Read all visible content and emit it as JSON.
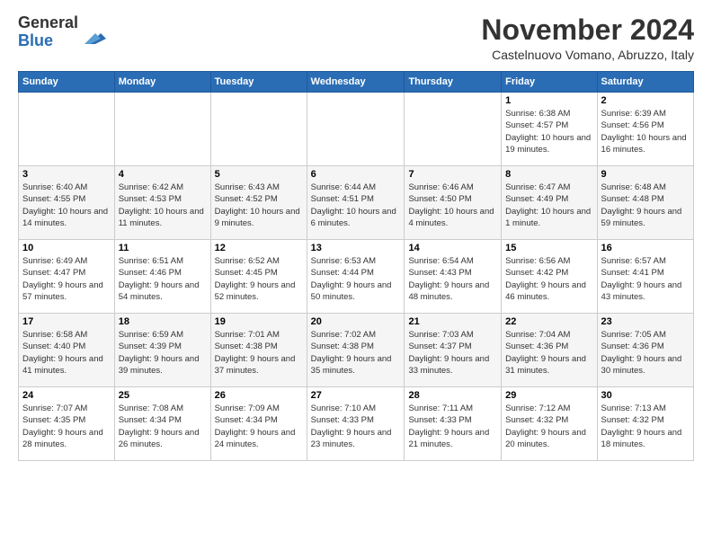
{
  "logo": {
    "line1": "General",
    "line2": "Blue"
  },
  "title": "November 2024",
  "location": "Castelnuovo Vomano, Abruzzo, Italy",
  "days_of_week": [
    "Sunday",
    "Monday",
    "Tuesday",
    "Wednesday",
    "Thursday",
    "Friday",
    "Saturday"
  ],
  "weeks": [
    [
      {
        "day": "",
        "info": ""
      },
      {
        "day": "",
        "info": ""
      },
      {
        "day": "",
        "info": ""
      },
      {
        "day": "",
        "info": ""
      },
      {
        "day": "",
        "info": ""
      },
      {
        "day": "1",
        "info": "Sunrise: 6:38 AM\nSunset: 4:57 PM\nDaylight: 10 hours and 19 minutes."
      },
      {
        "day": "2",
        "info": "Sunrise: 6:39 AM\nSunset: 4:56 PM\nDaylight: 10 hours and 16 minutes."
      }
    ],
    [
      {
        "day": "3",
        "info": "Sunrise: 6:40 AM\nSunset: 4:55 PM\nDaylight: 10 hours and 14 minutes."
      },
      {
        "day": "4",
        "info": "Sunrise: 6:42 AM\nSunset: 4:53 PM\nDaylight: 10 hours and 11 minutes."
      },
      {
        "day": "5",
        "info": "Sunrise: 6:43 AM\nSunset: 4:52 PM\nDaylight: 10 hours and 9 minutes."
      },
      {
        "day": "6",
        "info": "Sunrise: 6:44 AM\nSunset: 4:51 PM\nDaylight: 10 hours and 6 minutes."
      },
      {
        "day": "7",
        "info": "Sunrise: 6:46 AM\nSunset: 4:50 PM\nDaylight: 10 hours and 4 minutes."
      },
      {
        "day": "8",
        "info": "Sunrise: 6:47 AM\nSunset: 4:49 PM\nDaylight: 10 hours and 1 minute."
      },
      {
        "day": "9",
        "info": "Sunrise: 6:48 AM\nSunset: 4:48 PM\nDaylight: 9 hours and 59 minutes."
      }
    ],
    [
      {
        "day": "10",
        "info": "Sunrise: 6:49 AM\nSunset: 4:47 PM\nDaylight: 9 hours and 57 minutes."
      },
      {
        "day": "11",
        "info": "Sunrise: 6:51 AM\nSunset: 4:46 PM\nDaylight: 9 hours and 54 minutes."
      },
      {
        "day": "12",
        "info": "Sunrise: 6:52 AM\nSunset: 4:45 PM\nDaylight: 9 hours and 52 minutes."
      },
      {
        "day": "13",
        "info": "Sunrise: 6:53 AM\nSunset: 4:44 PM\nDaylight: 9 hours and 50 minutes."
      },
      {
        "day": "14",
        "info": "Sunrise: 6:54 AM\nSunset: 4:43 PM\nDaylight: 9 hours and 48 minutes."
      },
      {
        "day": "15",
        "info": "Sunrise: 6:56 AM\nSunset: 4:42 PM\nDaylight: 9 hours and 46 minutes."
      },
      {
        "day": "16",
        "info": "Sunrise: 6:57 AM\nSunset: 4:41 PM\nDaylight: 9 hours and 43 minutes."
      }
    ],
    [
      {
        "day": "17",
        "info": "Sunrise: 6:58 AM\nSunset: 4:40 PM\nDaylight: 9 hours and 41 minutes."
      },
      {
        "day": "18",
        "info": "Sunrise: 6:59 AM\nSunset: 4:39 PM\nDaylight: 9 hours and 39 minutes."
      },
      {
        "day": "19",
        "info": "Sunrise: 7:01 AM\nSunset: 4:38 PM\nDaylight: 9 hours and 37 minutes."
      },
      {
        "day": "20",
        "info": "Sunrise: 7:02 AM\nSunset: 4:38 PM\nDaylight: 9 hours and 35 minutes."
      },
      {
        "day": "21",
        "info": "Sunrise: 7:03 AM\nSunset: 4:37 PM\nDaylight: 9 hours and 33 minutes."
      },
      {
        "day": "22",
        "info": "Sunrise: 7:04 AM\nSunset: 4:36 PM\nDaylight: 9 hours and 31 minutes."
      },
      {
        "day": "23",
        "info": "Sunrise: 7:05 AM\nSunset: 4:36 PM\nDaylight: 9 hours and 30 minutes."
      }
    ],
    [
      {
        "day": "24",
        "info": "Sunrise: 7:07 AM\nSunset: 4:35 PM\nDaylight: 9 hours and 28 minutes."
      },
      {
        "day": "25",
        "info": "Sunrise: 7:08 AM\nSunset: 4:34 PM\nDaylight: 9 hours and 26 minutes."
      },
      {
        "day": "26",
        "info": "Sunrise: 7:09 AM\nSunset: 4:34 PM\nDaylight: 9 hours and 24 minutes."
      },
      {
        "day": "27",
        "info": "Sunrise: 7:10 AM\nSunset: 4:33 PM\nDaylight: 9 hours and 23 minutes."
      },
      {
        "day": "28",
        "info": "Sunrise: 7:11 AM\nSunset: 4:33 PM\nDaylight: 9 hours and 21 minutes."
      },
      {
        "day": "29",
        "info": "Sunrise: 7:12 AM\nSunset: 4:32 PM\nDaylight: 9 hours and 20 minutes."
      },
      {
        "day": "30",
        "info": "Sunrise: 7:13 AM\nSunset: 4:32 PM\nDaylight: 9 hours and 18 minutes."
      }
    ]
  ]
}
